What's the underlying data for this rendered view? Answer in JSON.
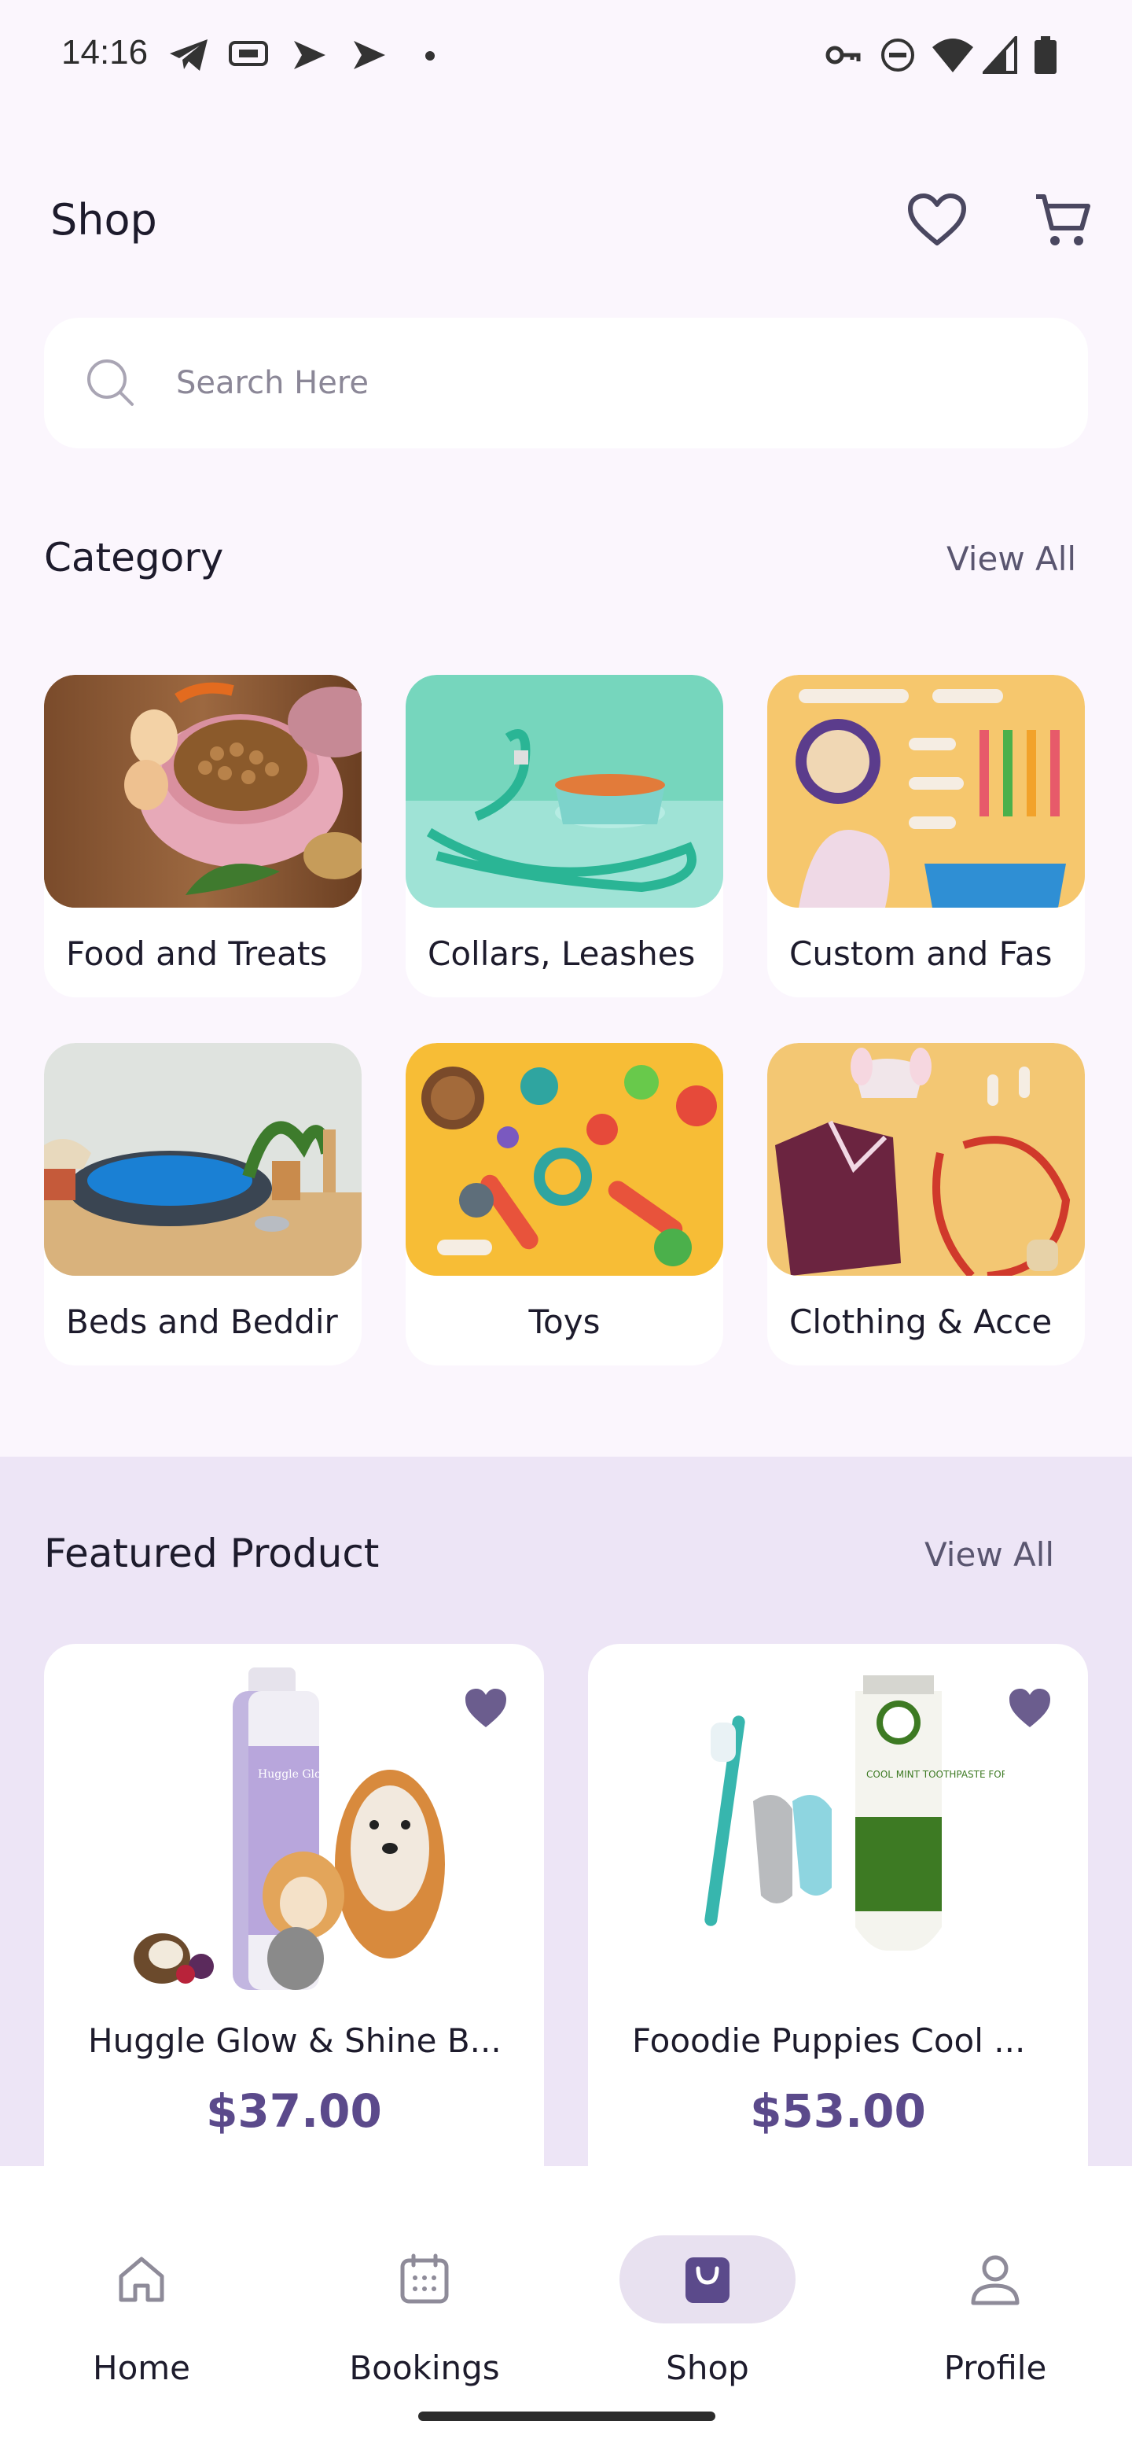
{
  "status_bar": {
    "time": "14:16",
    "left_icons": [
      "telegram-icon",
      "ticket-icon",
      "play-store-icon",
      "play-store-icon",
      "dot-icon"
    ],
    "right_icons": [
      "vpn-key-icon",
      "do-not-disturb-icon",
      "wifi-icon",
      "signal-icon",
      "battery-icon"
    ]
  },
  "header": {
    "title": "Shop",
    "icons": [
      "heart-outline-icon",
      "cart-icon"
    ]
  },
  "search": {
    "placeholder": "Search Here"
  },
  "category": {
    "title": "Category",
    "view_all": "View All",
    "items": [
      {
        "label": "Food and Treats"
      },
      {
        "label": "Collars, Leashes"
      },
      {
        "label": "Custom and Fas"
      },
      {
        "label": "Beds and Beddir"
      },
      {
        "label": "Toys"
      },
      {
        "label": "Clothing & Acce"
      }
    ]
  },
  "featured": {
    "title": "Featured Product",
    "view_all": "View All",
    "products": [
      {
        "name": "Huggle Glow & Shine B...",
        "price": "$37.00",
        "image_text": "Huggle Glow & Shine"
      },
      {
        "name": "Fooodie Puppies Cool ...",
        "price": "$53.00",
        "image_text": "COOL MINT TOOTHPASTE FOR DOGS"
      }
    ]
  },
  "bottom_nav": {
    "items": [
      {
        "label": "Home",
        "icon": "home-icon"
      },
      {
        "label": "Bookings",
        "icon": "calendar-icon"
      },
      {
        "label": "Shop",
        "icon": "shopping-bag-icon",
        "active": true
      },
      {
        "label": "Profile",
        "icon": "person-icon"
      }
    ]
  },
  "colors": {
    "background": "#fbf6fd",
    "featured_band": "#ede5f6",
    "accent": "#5b4a8b",
    "active_nav_pill": "#e8e1f0"
  }
}
